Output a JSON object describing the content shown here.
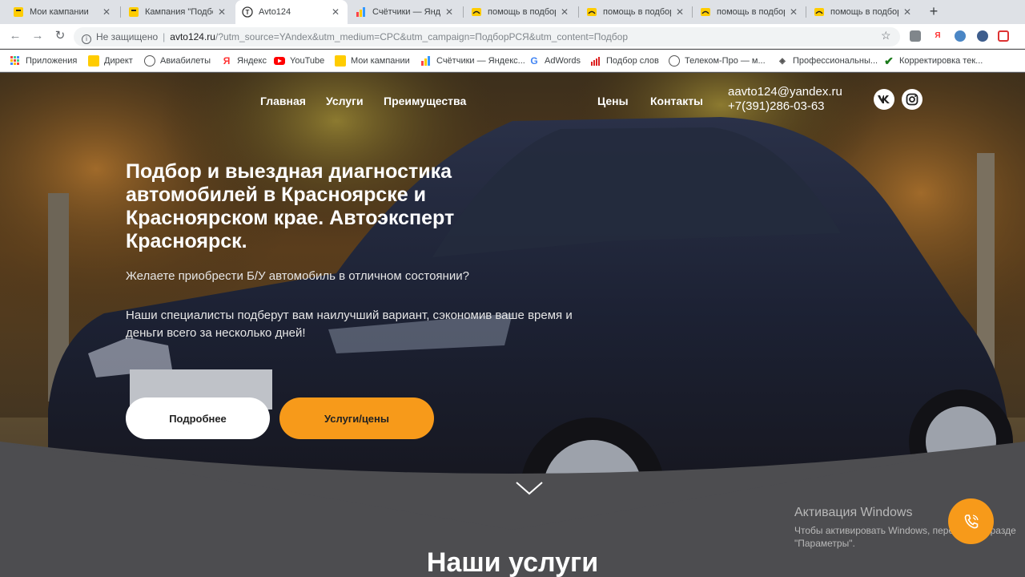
{
  "browser": {
    "tabs": [
      {
        "title": "Мои кампании",
        "icon": "direct-icon"
      },
      {
        "title": "Кампания \"Подбор",
        "icon": "direct-icon"
      },
      {
        "title": "Avto124",
        "icon": "avto124-icon"
      },
      {
        "title": "Счётчики — Яндекс",
        "icon": "metrika-icon"
      },
      {
        "title": "помощь в подборе",
        "icon": "smile-icon"
      },
      {
        "title": "помощь в подборе",
        "icon": "smile-icon"
      },
      {
        "title": "помощь в подборе",
        "icon": "smile-icon"
      },
      {
        "title": "помощь в подборе",
        "icon": "smile-icon"
      }
    ],
    "address": {
      "security": "Не защищено",
      "host": "avto124.ru",
      "path": "/?utm_source=YAndex&utm_medium=CPC&utm_campaign=ПодборРСЯ&utm_content=Подбор"
    },
    "bookmarks": [
      {
        "label": "Приложения",
        "icon": "apps-icon"
      },
      {
        "label": "Директ",
        "icon": "direct-icon"
      },
      {
        "label": "Авиабилеты",
        "icon": "globe-icon"
      },
      {
        "label": "Яндекс",
        "icon": "yandex-icon"
      },
      {
        "label": "YouTube",
        "icon": "youtube-icon"
      },
      {
        "label": "Мои кампании",
        "icon": "direct-icon"
      },
      {
        "label": "Счётчики — Яндекс...",
        "icon": "metrika-icon"
      },
      {
        "label": "AdWords",
        "icon": "google-icon"
      },
      {
        "label": "Подбор слов",
        "icon": "chart-icon"
      },
      {
        "label": "Телеком-Про — м...",
        "icon": "globe-icon"
      },
      {
        "label": "Профессиональны...",
        "icon": "tag-icon"
      },
      {
        "label": "Корректировка тек...",
        "icon": "check-icon"
      }
    ]
  },
  "site": {
    "nav": [
      "Главная",
      "Услуги",
      "Преимущества",
      "Цены",
      "Контакты"
    ],
    "email": "aavto124@yandex.ru",
    "phone": "+7(391)286-03-63",
    "headline": "Подбор и выездная диагностика автомобилей в Красноярске и Красноярском крае. Автоэксперт Красноярск.",
    "lead": "Желаете приобрести Б/У автомобиль в отличном состоянии?",
    "lead2": "Наши специалисты подберут вам наилучший вариант, сэкономив ваше время и деньги всего за несколько дней!",
    "btn_more": "Подробнее",
    "btn_services": "Услуги/цены",
    "section_title": "Наши услуги",
    "accent": "#f79a1a"
  },
  "os": {
    "activation_title": "Активация Windows",
    "activation_text1": "Чтобы активировать Windows, перейдите в разде",
    "activation_text2": "\"Параметры\"."
  }
}
